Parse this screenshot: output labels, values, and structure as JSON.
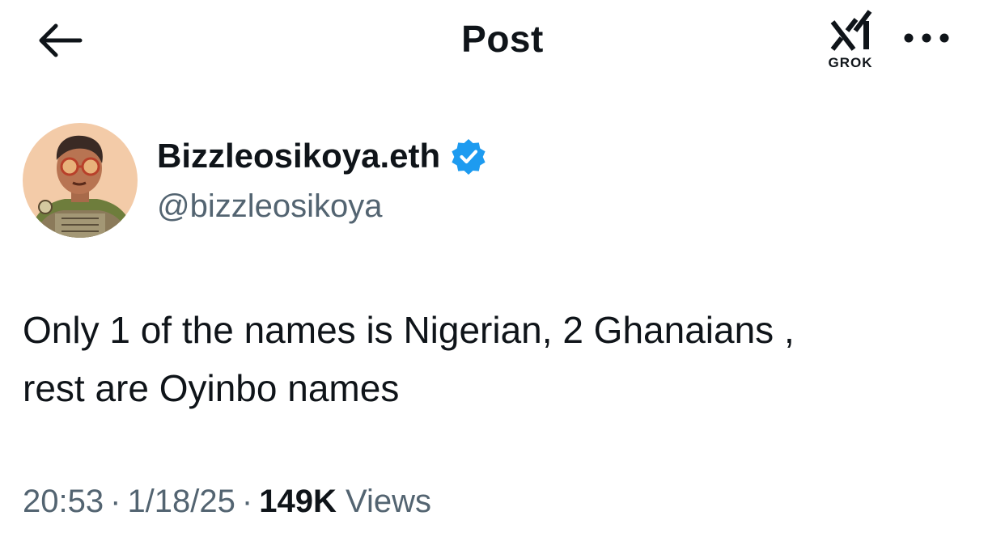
{
  "header": {
    "title": "Post",
    "back_icon": "arrow-left-icon",
    "grok_label": "GROK",
    "grok_icon": "xai-grok-logo-icon",
    "more_icon": "more-horizontal-icon"
  },
  "post": {
    "author": {
      "display_name": "Bizzleosikoya.eth",
      "handle": "@bizzleosikoya",
      "verified": true,
      "verified_color": "#1d9bf0"
    },
    "text": "Only 1 of the names is Nigerian, 2 Ghanaians ,\nrest are Oyinbo names",
    "meta": {
      "time": "20:53",
      "separator": "·",
      "date": "1/18/25",
      "views_count": "149K",
      "views_label": "Views"
    }
  },
  "colors": {
    "text_primary": "#0f1419",
    "text_secondary": "#536471",
    "accent": "#1d9bf0",
    "background": "#ffffff"
  }
}
